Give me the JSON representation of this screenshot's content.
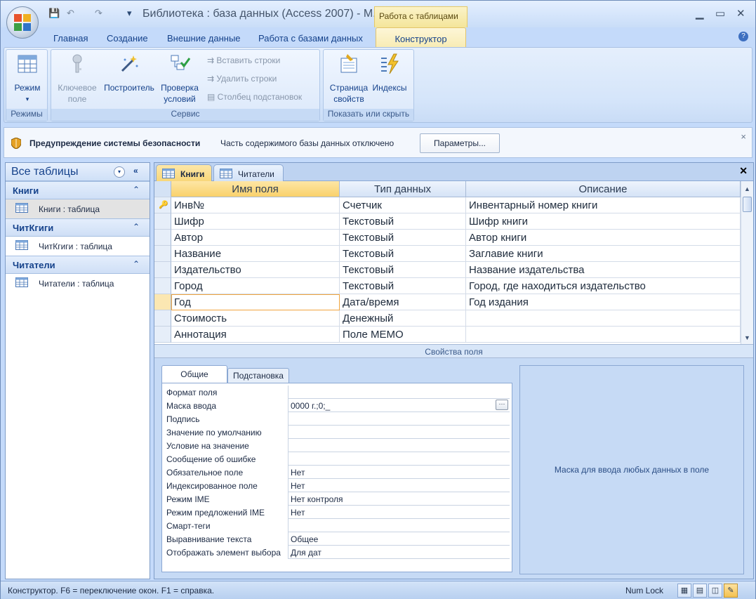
{
  "window": {
    "title": "Библиотека : база данных (Access 2007) - М.",
    "context_tab_header": "Работа с таблицами",
    "minimize": "▁",
    "maximize": "▭",
    "close": "✕",
    "help": "?"
  },
  "quick_access": {
    "save": "💾",
    "undo": "↶",
    "redo": "↷",
    "customize": "▾"
  },
  "ribbon_tabs": [
    {
      "label": "Главная"
    },
    {
      "label": "Создание"
    },
    {
      "label": "Внешние данные"
    },
    {
      "label": "Работа с базами данных"
    },
    {
      "label": "Конструктор",
      "active": true
    }
  ],
  "ribbon": {
    "groups": [
      {
        "label": "Режимы",
        "buttons": [
          {
            "label": "Режим",
            "sub": "▾"
          }
        ]
      },
      {
        "label": "Сервис",
        "buttons": [
          {
            "label": "Ключевое поле",
            "disabled": true
          },
          {
            "label": "Построитель"
          },
          {
            "label": "Проверка условий"
          }
        ],
        "small_buttons": [
          "Вставить строки",
          "Удалить строки",
          "Столбец подстановок"
        ]
      },
      {
        "label": "Показать или скрыть",
        "buttons": [
          {
            "label": "Страница свойств"
          },
          {
            "label": "Индексы"
          }
        ]
      }
    ]
  },
  "security_bar": {
    "title": "Предупреждение системы безопасности",
    "message": "Часть содержимого базы данных отключено",
    "button": "Параметры...",
    "close": "×"
  },
  "nav_pane": {
    "title": "Все таблицы",
    "dropdown": "▾",
    "collapse": "«",
    "groups": [
      {
        "label": "Книги",
        "chevron": "⌃",
        "items": [
          {
            "label": "Книги : таблица",
            "selected": true
          }
        ]
      },
      {
        "label": "ЧитКгиги",
        "chevron": "⌃",
        "items": [
          {
            "label": "ЧитКгиги : таблица"
          }
        ]
      },
      {
        "label": "Читатели",
        "chevron": "⌃",
        "items": [
          {
            "label": "Читатели : таблица"
          }
        ]
      }
    ]
  },
  "doc_tabs": [
    {
      "label": "Книги",
      "active": true
    },
    {
      "label": "Читатели"
    }
  ],
  "doc_close": "✕",
  "design_grid": {
    "headers": [
      "Имя поля",
      "Тип данных",
      "Описание"
    ],
    "rows": [
      {
        "name": "Инв№",
        "type": "Счетчик",
        "desc": "Инвентарный номер книги",
        "key": true
      },
      {
        "name": "Шифр",
        "type": "Текстовый",
        "desc": "Шифр книги"
      },
      {
        "name": "Автор",
        "type": "Текстовый",
        "desc": "Автор книги"
      },
      {
        "name": "Название",
        "type": "Текстовый",
        "desc": "Заглавие книги"
      },
      {
        "name": "Издательство",
        "type": "Текстовый",
        "desc": "Название издательства"
      },
      {
        "name": "Город",
        "type": "Текстовый",
        "desc": "Город, где находиться издательство"
      },
      {
        "name": "Год",
        "type": "Дата/время",
        "desc": "Год издания",
        "current": true
      },
      {
        "name": "Стоимость",
        "type": "Денежный",
        "desc": ""
      },
      {
        "name": "Аннотация",
        "type": "Поле МЕМО",
        "desc": ""
      }
    ]
  },
  "field_properties": {
    "strip_label": "Свойства поля",
    "tabs": [
      "Общие",
      "Подстановка"
    ],
    "rows": [
      {
        "label": "Формат поля",
        "value": ""
      },
      {
        "label": "Маска ввода",
        "value": "0000 г.;0;_",
        "builder": "···"
      },
      {
        "label": "Подпись",
        "value": ""
      },
      {
        "label": "Значение по умолчанию",
        "value": ""
      },
      {
        "label": "Условие на значение",
        "value": ""
      },
      {
        "label": "Сообщение об ошибке",
        "value": ""
      },
      {
        "label": "Обязательное поле",
        "value": "Нет"
      },
      {
        "label": "Индексированное поле",
        "value": "Нет"
      },
      {
        "label": "Режим IME",
        "value": "Нет контроля"
      },
      {
        "label": "Режим предложений IME",
        "value": "Нет"
      },
      {
        "label": "Смарт-теги",
        "value": ""
      },
      {
        "label": "Выравнивание текста",
        "value": "Общее"
      },
      {
        "label": "Отображать элемент выбора",
        "value": "Для дат"
      }
    ],
    "hint": "Маска для ввода любых данных в поле"
  },
  "status_bar": {
    "text": "Конструктор.  F6 = переключение окон.  F1 = справка.",
    "numlock": "Num Lock",
    "views": [
      "▦",
      "▤",
      "◫",
      "✎"
    ]
  }
}
